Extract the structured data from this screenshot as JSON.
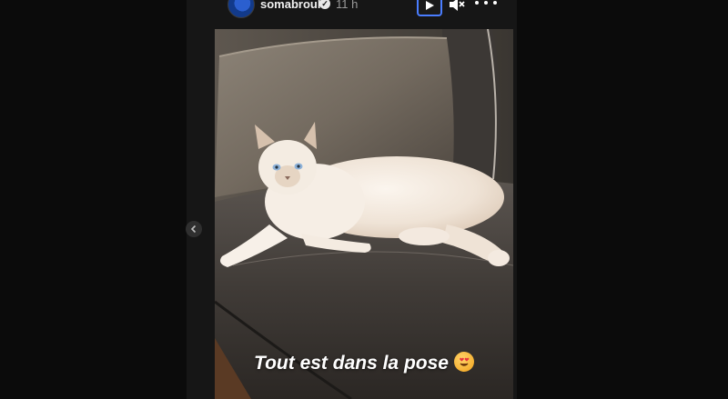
{
  "header": {
    "username": "somabrouk",
    "verified_icon": "verified-badge-icon",
    "time": "11 h",
    "play_icon": "play-icon",
    "mute_icon": "speaker-muted-icon",
    "more_icon": "more-horizontal-icon"
  },
  "story": {
    "caption": "Tout est dans la pose",
    "caption_emoji": "heart-eyes-cat-emoji"
  },
  "nav": {
    "prev_icon": "chevron-left-icon"
  },
  "colors": {
    "background": "#0c0c0c",
    "accent": "#4a7dff"
  }
}
